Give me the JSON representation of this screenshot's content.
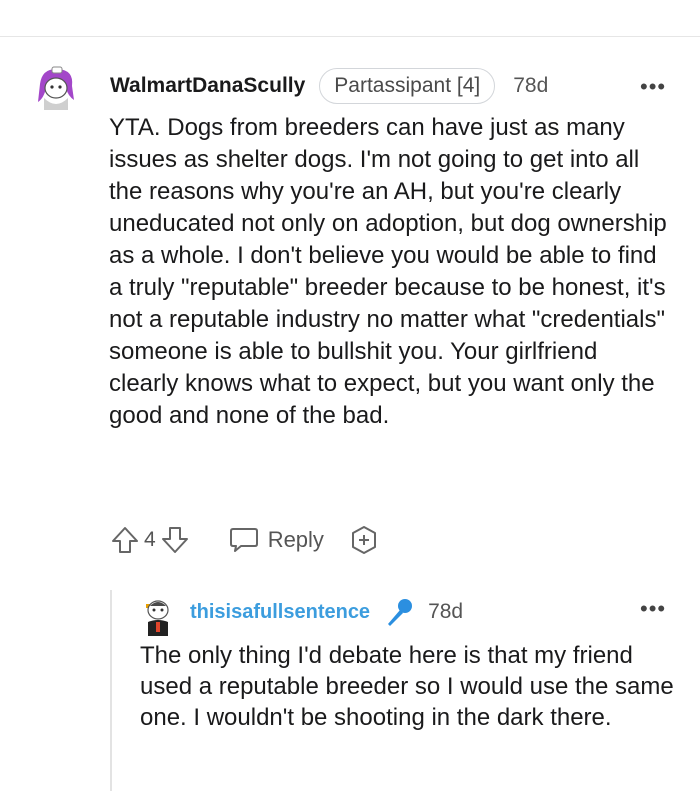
{
  "comment": {
    "username": "WalmartDanaScully",
    "flair": "Partassipant [4]",
    "time": "78d",
    "more": "•••",
    "body": "YTA. Dogs from breeders can have just as many issues as shelter dogs. I'm not going to get into all the reasons why you're an AH, but you're clearly uneducated not only on adoption, but dog ownership as a whole. I don't believe you would be able to find a truly \"reputable\" breeder because to be honest, it's not a reputable industry no matter what \"credentials\" someone is able to bullshit you. Your girlfriend clearly knows what to expect, but you want only the good and none of the bad.",
    "votes": "4",
    "reply_label": "Reply"
  },
  "reply": {
    "username": "thisisafullsentence",
    "time": "78d",
    "more": "•••",
    "body": "The only thing I'd debate here is that my friend used a reputable breeder so I would use the same one. I wouldn't be shooting in the dark there."
  },
  "icons": {
    "upvote": "arrow-up-outline",
    "downvote": "arrow-down-outline",
    "reply": "speech-bubble",
    "award": "award-plus",
    "mic": "microphone"
  },
  "colors": {
    "username_reply": "#3c9dde",
    "avatar_hair": "#a347c9",
    "mic": "#2b8fe0"
  }
}
